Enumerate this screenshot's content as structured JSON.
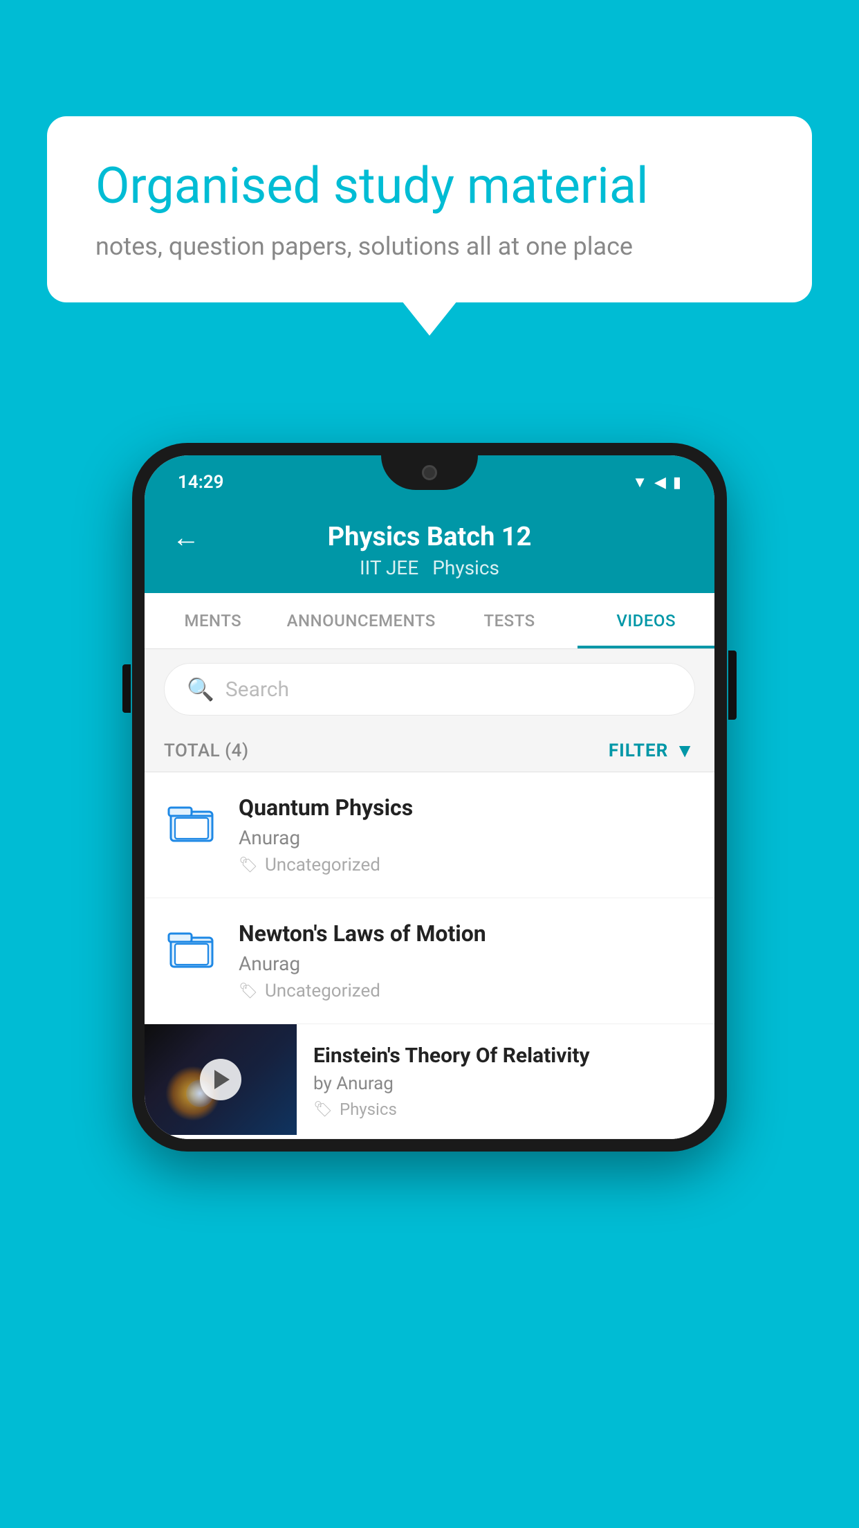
{
  "background_color": "#00bcd4",
  "speech_bubble": {
    "heading": "Organised study material",
    "subtext": "notes, question papers, solutions all at one place"
  },
  "phone": {
    "status_bar": {
      "time": "14:29",
      "icons": [
        "wifi",
        "signal",
        "battery"
      ]
    },
    "app_bar": {
      "title": "Physics Batch 12",
      "subtitle_left": "IIT JEE",
      "subtitle_right": "Physics",
      "back_label": "←"
    },
    "tabs": [
      {
        "label": "MENTS",
        "active": false
      },
      {
        "label": "ANNOUNCEMENTS",
        "active": false
      },
      {
        "label": "TESTS",
        "active": false
      },
      {
        "label": "VIDEOS",
        "active": true
      }
    ],
    "search": {
      "placeholder": "Search"
    },
    "filter": {
      "total_label": "TOTAL (4)",
      "filter_label": "FILTER"
    },
    "list_items": [
      {
        "title": "Quantum Physics",
        "author": "Anurag",
        "tag": "Uncategorized",
        "has_thumbnail": false
      },
      {
        "title": "Newton's Laws of Motion",
        "author": "Anurag",
        "tag": "Uncategorized",
        "has_thumbnail": false
      },
      {
        "title": "Einstein's Theory Of Relativity",
        "author": "by Anurag",
        "tag": "Physics",
        "has_thumbnail": true
      }
    ]
  }
}
